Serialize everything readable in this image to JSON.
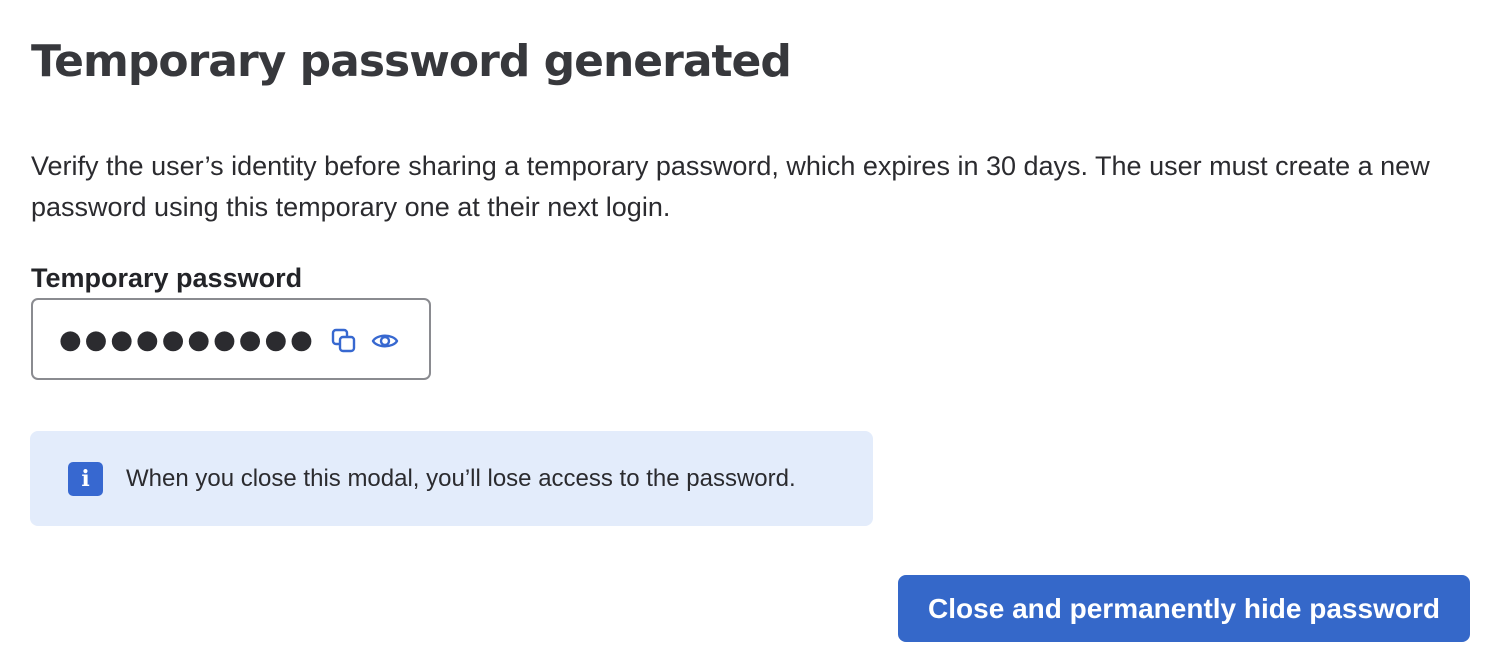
{
  "modal": {
    "title": "Temporary password generated",
    "description": "Verify the user’s identity before sharing a temporary password, which expires in 30 days. The user must create a new password using this temporary one at their next login."
  },
  "password_field": {
    "label": "Temporary password",
    "masked_value": "●●●●●●●●●●",
    "copy_icon": "copy-icon",
    "visibility_icon": "eye-icon"
  },
  "info_banner": {
    "icon": "info-icon",
    "icon_glyph": "i",
    "text": "When you close this modal, you’ll lose access to the password."
  },
  "actions": {
    "close_label": "Close and permanently hide password"
  },
  "colors": {
    "accent": "#3568c9",
    "info_background": "#e3ecfb",
    "icon_blue": "#3768d0",
    "text": "#2b2b2f",
    "field_border": "#8a8b90"
  }
}
